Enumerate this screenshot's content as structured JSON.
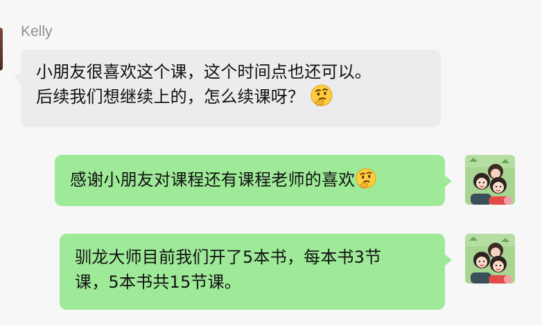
{
  "chat": {
    "sender_name": "Kelly",
    "messages": [
      {
        "direction": "incoming",
        "lines": [
          "小朋友很喜欢这个课，这个时间点也还可以。",
          "后续我们想继续上的，怎么续课呀？"
        ],
        "emoji": "thinking-face-icon"
      },
      {
        "direction": "outgoing",
        "lines": [
          "感谢小朋友对课程还有课程老师的喜欢"
        ],
        "emoji": "thinking-face-icon"
      },
      {
        "direction": "outgoing",
        "lines": [
          "驯龙大师目前我们开了5本书，每本书3节",
          "课，5本书共15节课。"
        ]
      }
    ]
  },
  "colors": {
    "background": "#f7f7f8",
    "incoming_bubble": "#ececef",
    "outgoing_bubble": "#9eea98",
    "sender_name": "#8d8d92"
  }
}
